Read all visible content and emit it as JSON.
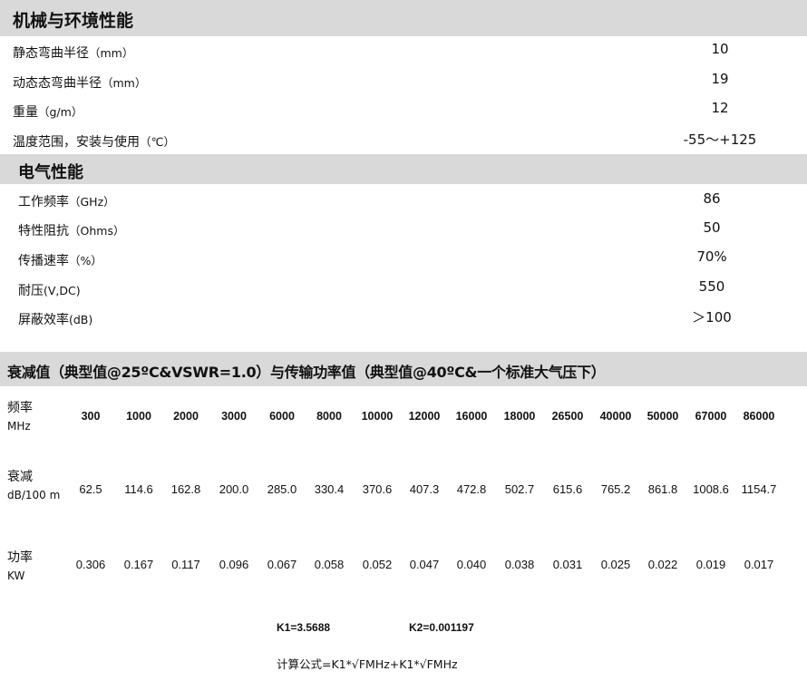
{
  "mechanical": {
    "title": "机械与环境性能",
    "rows": [
      {
        "label": "静态弯曲半径",
        "unit": "（mm）",
        "value": "10"
      },
      {
        "label": "动态态弯曲半径",
        "unit": "（mm）",
        "value": "19"
      },
      {
        "label": "重量",
        "unit": "（g/m）",
        "value": "12"
      },
      {
        "label": "温度范围，安装与使用",
        "unit": "（℃）",
        "value": "-55～+125"
      }
    ]
  },
  "electrical": {
    "title": "电气性能",
    "rows": [
      {
        "label": "工作频率",
        "unit": "（GHz）",
        "value": "86"
      },
      {
        "label": "特性阻抗",
        "unit": "（Ohms）",
        "value": "50"
      },
      {
        "label": "传播速率",
        "unit": "（%）",
        "value": "70%"
      },
      {
        "label": "耐压",
        "unit": "(V,DC)",
        "value": "550"
      },
      {
        "label": "屏蔽效率",
        "unit": "(dB)",
        "value": "＞100"
      }
    ]
  },
  "attenuation": {
    "title": "衰减值（典型值@25ºC&VSWR=1.0）与传输功率值（典型值@40ºC&一个标准大气压下）",
    "freq_label": "频率",
    "freq_unit": "MHz",
    "atten_label": "衰减",
    "atten_unit": "dB/100 m",
    "power_label": "功率",
    "power_unit": "KW",
    "frequencies": [
      "300",
      "1000",
      "2000",
      "3000",
      "6000",
      "8000",
      "10000",
      "12000",
      "16000",
      "18000",
      "26500",
      "40000",
      "50000",
      "67000",
      "86000"
    ],
    "attenuation": [
      "62.5",
      "114.6",
      "162.8",
      "200.0",
      "285.0",
      "330.4",
      "370.6",
      "407.3",
      "472.8",
      "502.7",
      "615.6",
      "765.2",
      "861.8",
      "1008.6",
      "1154.7"
    ],
    "power": [
      "0.306",
      "0.167",
      "0.117",
      "0.096",
      "0.067",
      "0.058",
      "0.052",
      "0.047",
      "0.040",
      "0.038",
      "0.031",
      "0.025",
      "0.022",
      "0.019",
      "0.017"
    ]
  },
  "constants": {
    "k1": "K1=3.5688",
    "k2": "K2=0.001197",
    "formula": "计算公式=K1*√FMHz+K1*√FMHz"
  }
}
